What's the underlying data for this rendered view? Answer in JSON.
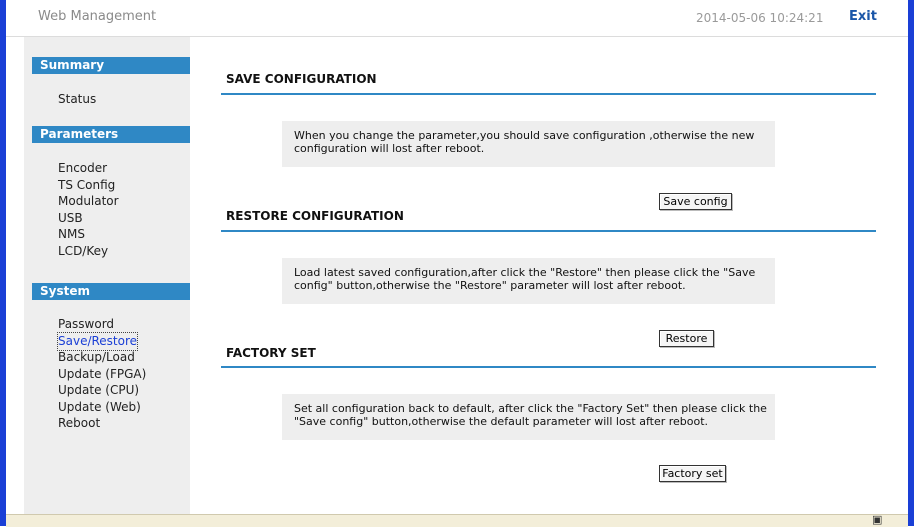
{
  "header": {
    "title": "Web Management",
    "datetime": "2014-05-06 10:24:21",
    "exit_label": "Exit"
  },
  "sidebar": {
    "sections": [
      {
        "title": "Summary",
        "items": [
          "Status"
        ]
      },
      {
        "title": "Parameters",
        "items": [
          "Encoder",
          "TS Config",
          "Modulator",
          "USB",
          "NMS",
          "LCD/Key"
        ]
      },
      {
        "title": "System",
        "items": [
          "Password",
          "Save/Restore",
          "Backup/Load",
          "Update (FPGA)",
          "Update (CPU)",
          "Update (Web)",
          "Reboot"
        ]
      }
    ],
    "active_item": "Save/Restore"
  },
  "main": {
    "save": {
      "title": "SAVE CONFIGURATION",
      "text": "When you change the parameter,you should save configuration ,otherwise the new configuration will lost after reboot.",
      "button": "Save config"
    },
    "restore": {
      "title": "RESTORE CONFIGURATION",
      "text": "Load latest saved configuration,after click the \"Restore\" then please click the \"Save config\" button,otherwise the \"Restore\" parameter will lost after reboot.",
      "button": "Restore"
    },
    "factory": {
      "title": "FACTORY SET",
      "text": "Set all configuration back to default, after click the \"Factory Set\" then please click the \"Save config\" button,otherwise the default parameter will lost after reboot.",
      "button": "Factory set"
    }
  },
  "statusbar": {
    "icon": "page-icon"
  },
  "colors": {
    "accent": "#2f88c5",
    "frame": "#1a3fd6",
    "panel": "#eeeeee"
  }
}
